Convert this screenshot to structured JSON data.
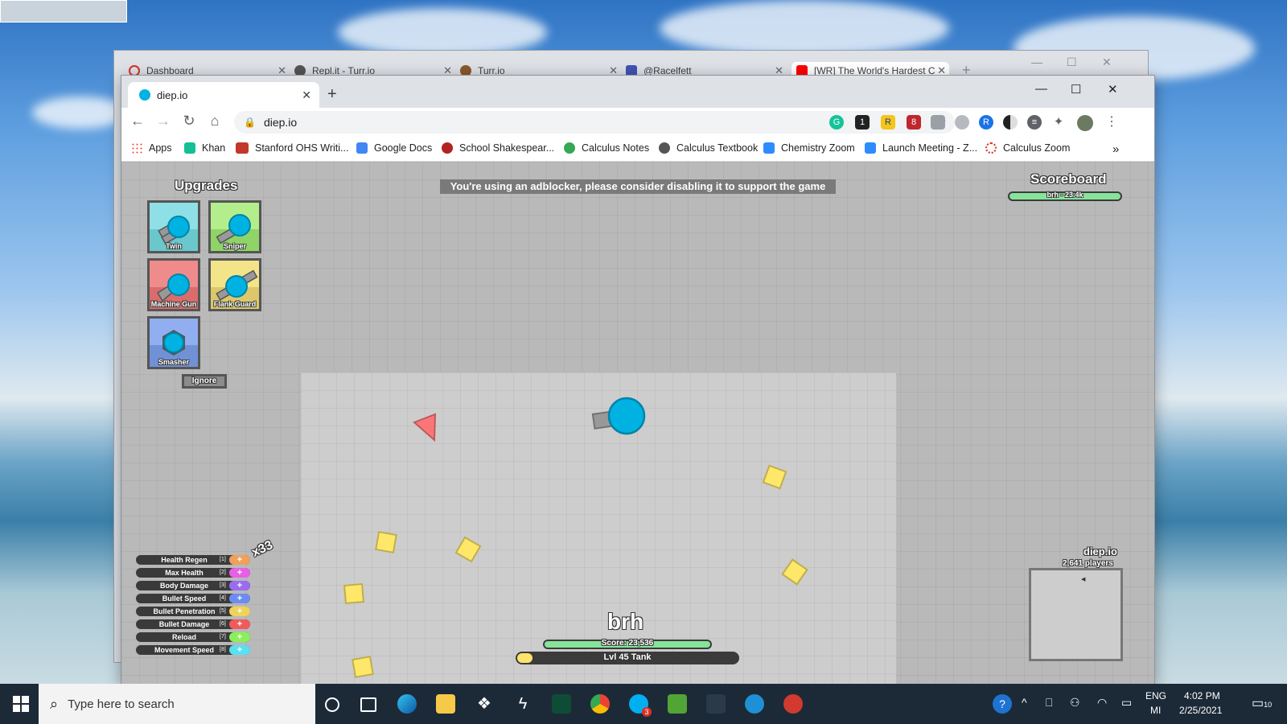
{
  "back_window": {
    "tabs": [
      {
        "label": "Dashboard",
        "color": "#d93025"
      },
      {
        "label": "Repl.it - Turr.io",
        "color": "#555555"
      },
      {
        "label": "Turr.io",
        "color": "#8a5a2b"
      },
      {
        "label": "@Racelfett",
        "color": "#4054b2"
      },
      {
        "label": "[WR] The World's Hardest C",
        "color": "#ff0000"
      }
    ]
  },
  "browser": {
    "tab_title": "diep.io",
    "url": "diep.io",
    "new_tab": "+",
    "extension_badges": {
      "ext1": "1",
      "ext2": "8"
    },
    "bookmarks": [
      {
        "label": "Apps",
        "color": "#4285f4"
      },
      {
        "label": "Khan",
        "color": "#14bf96"
      },
      {
        "label": "Stanford OHS Writi...",
        "color": "#c0392b"
      },
      {
        "label": "Google Docs",
        "color": "#4285f4"
      },
      {
        "label": "School Shakespear...",
        "color": "#b22222"
      },
      {
        "label": "Calculus Notes",
        "color": "#34a853"
      },
      {
        "label": "Calculus Textbook",
        "color": "#555555"
      },
      {
        "label": "Chemistry Zoom",
        "color": "#2d8cff"
      },
      {
        "label": "Launch Meeting - Z...",
        "color": "#2d8cff"
      },
      {
        "label": "Calculus Zoom",
        "color": "#d93025"
      }
    ],
    "overflow": "»"
  },
  "game": {
    "ad_banner": "You're using an adblocker, please consider disabling it to support the game",
    "upgrades_title": "Upgrades",
    "upgrades": [
      {
        "label": "Twin",
        "bg": "#8ee0e6",
        "bg2": "#6ac7cc"
      },
      {
        "label": "Sniper",
        "bg": "#b4ee8c",
        "bg2": "#8fd466"
      },
      {
        "label": "Machine Gun",
        "bg": "#ef8b8b",
        "bg2": "#d96c6c"
      },
      {
        "label": "Flank Guard",
        "bg": "#f3e48a",
        "bg2": "#dcc86a"
      },
      {
        "label": "Smasher",
        "bg": "#91aff0",
        "bg2": "#7091d6"
      }
    ],
    "ignore_label": "Ignore",
    "scoreboard_title": "Scoreboard",
    "scoreboard_entry": "brh - 23.4k",
    "stats": [
      {
        "name": "Health Regen",
        "key": "[1]",
        "color": "#f0a05a"
      },
      {
        "name": "Max Health",
        "key": "[2]",
        "color": "#e75fe6"
      },
      {
        "name": "Body Damage",
        "key": "[3]",
        "color": "#9a6cf0"
      },
      {
        "name": "Bullet Speed",
        "key": "[4]",
        "color": "#6c8cf0"
      },
      {
        "name": "Bullet Penetration",
        "key": "[5]",
        "color": "#f0d35a"
      },
      {
        "name": "Bullet Damage",
        "key": "[6]",
        "color": "#f05a5a"
      },
      {
        "name": "Reload",
        "key": "[7]",
        "color": "#8af05a"
      },
      {
        "name": "Movement Speed",
        "key": "[8]",
        "color": "#5ae0f0"
      }
    ],
    "stat_plus": "+",
    "points_available": "x33",
    "player_name": "brh",
    "score_text": "Score: 23,536",
    "level_text": "Lvl 45 Tank",
    "level_progress": 0.07,
    "minimap_title": "diep.io",
    "player_count": "2,641 players",
    "colors": {
      "player": "#00b2e1",
      "square": "#ffe869",
      "triangle": "#fc7677",
      "arena": "#cdcdcd",
      "outside": "#b9b9b9"
    }
  },
  "taskbar": {
    "search_placeholder": "Type here to search",
    "language": "ENG",
    "language_sub": "MI",
    "time": "4:02 PM",
    "date": "2/25/2021",
    "skype_badge": "3",
    "notification_count": "10"
  }
}
